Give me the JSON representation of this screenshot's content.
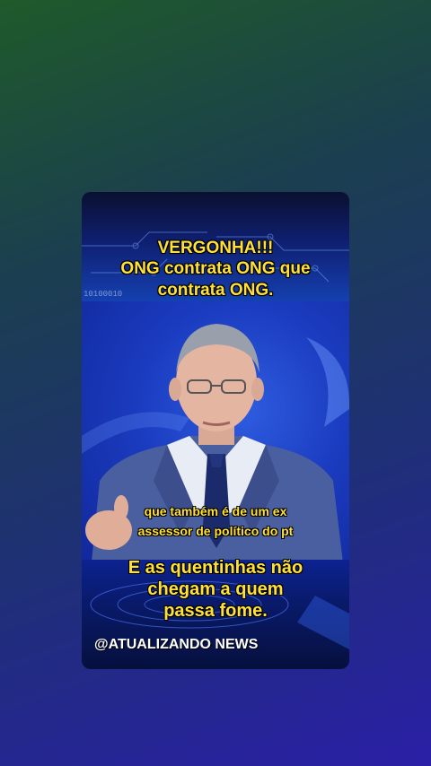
{
  "post": {
    "headline_title": "VERGONHA!!!",
    "headline_line1": "ONG contrata ONG que",
    "headline_line2": "contrata ONG.",
    "subtitle_line1": "que também é de um ex",
    "subtitle_line2": "assessor de político do pt",
    "caption_line1": "E as quentinhas não",
    "caption_line2": "chegam a quem",
    "caption_line3": "passa fome.",
    "watermark": "@ATUALIZANDO NEWS"
  },
  "background_texts": {
    "binary": "10100010"
  },
  "colors": {
    "caption_yellow": "#ffe13a",
    "studio_blue": "#1b3cc0",
    "suit": "#4a5fa0",
    "tie": "#1a2a6a"
  },
  "icons": {
    "presenter": "news-anchor-figure"
  }
}
